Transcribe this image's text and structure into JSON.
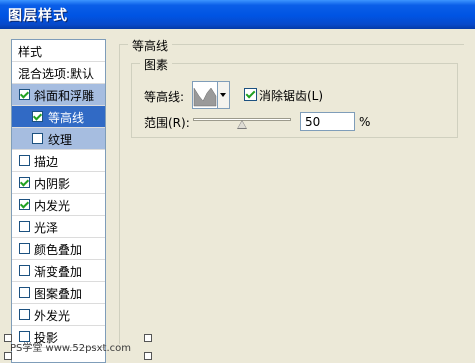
{
  "window": {
    "title": "图层样式"
  },
  "styles_panel": {
    "header": "样式",
    "blend_options": "混合选项:默认",
    "items": [
      {
        "label": "斜面和浮雕",
        "checked": true,
        "state": "parent-selected"
      },
      {
        "label": "等高线",
        "checked": true,
        "state": "selected"
      },
      {
        "label": "纹理",
        "checked": false,
        "state": "parent-selected"
      },
      {
        "label": "描边",
        "checked": false
      },
      {
        "label": "内阴影",
        "checked": true
      },
      {
        "label": "内发光",
        "checked": true
      },
      {
        "label": "光泽",
        "checked": false
      },
      {
        "label": "颜色叠加",
        "checked": false
      },
      {
        "label": "渐变叠加",
        "checked": false
      },
      {
        "label": "图案叠加",
        "checked": false
      },
      {
        "label": "外发光",
        "checked": false
      },
      {
        "label": "投影",
        "checked": false
      }
    ]
  },
  "contour_section": {
    "title": "等高线",
    "group_title": "图素",
    "contour_label": "等高线:",
    "antialias_label": "消除锯齿(L)",
    "antialias_checked": true,
    "range_label": "范围(R):",
    "range_value": "50",
    "range_unit": "%"
  },
  "watermark": "PS学堂 www.52psxt.com",
  "colors": {
    "titlebar": "#0054e3",
    "selected": "#316ac5",
    "parent_selected": "#a6bde0",
    "checkmark": "#21a121"
  }
}
